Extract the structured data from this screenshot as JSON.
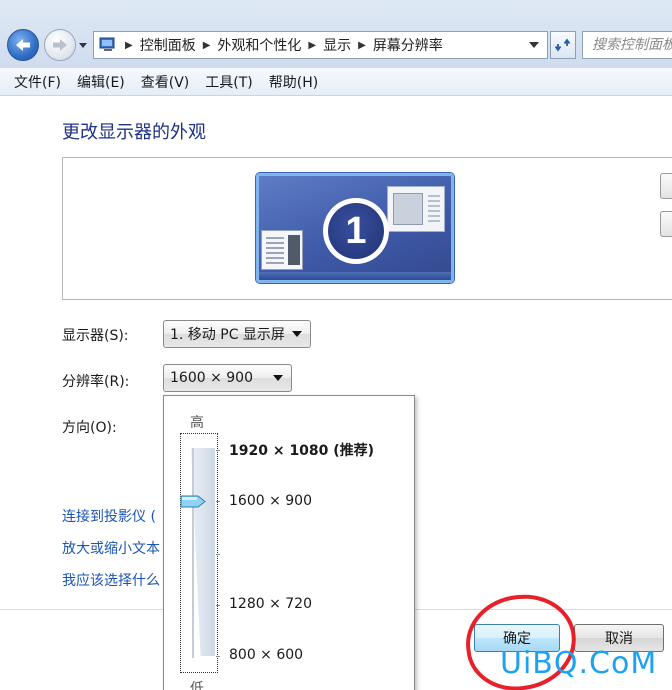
{
  "address_bar": {
    "breadcrumbs": [
      "控制面板",
      "外观和个性化",
      "显示",
      "屏幕分辨率"
    ],
    "search_placeholder": "搜索控制面板"
  },
  "menu": [
    "文件(F)",
    "编辑(E)",
    "查看(V)",
    "工具(T)",
    "帮助(H)"
  ],
  "main": {
    "title": "更改显示器的外观",
    "monitor_number": "1",
    "display_label": "显示器(S):",
    "display_value": "1. 移动 PC 显示屏",
    "resolution_label": "分辨率(R):",
    "resolution_value": "1600 × 900",
    "orientation_label": "方向(O):",
    "links": [
      "连接到投影仪 (",
      "放大或缩小文本",
      "我应该选择什么"
    ],
    "ok_label": "确定",
    "cancel_label": "取消"
  },
  "resolution_popup": {
    "high_label": "高",
    "low_label": "低",
    "options": [
      {
        "label": "1920 × 1080 (推荐)",
        "recommended": true
      },
      {
        "label": "1600 × 900",
        "selected": true
      },
      {
        "label": "1280 × 720"
      },
      {
        "label": "800 × 600"
      }
    ]
  },
  "watermark": "UiBQ.CoM",
  "colors": {
    "title": "#1e3287",
    "link": "#1a55b5",
    "highlight_circle": "#e8202a",
    "watermark": "#1da1f2"
  }
}
